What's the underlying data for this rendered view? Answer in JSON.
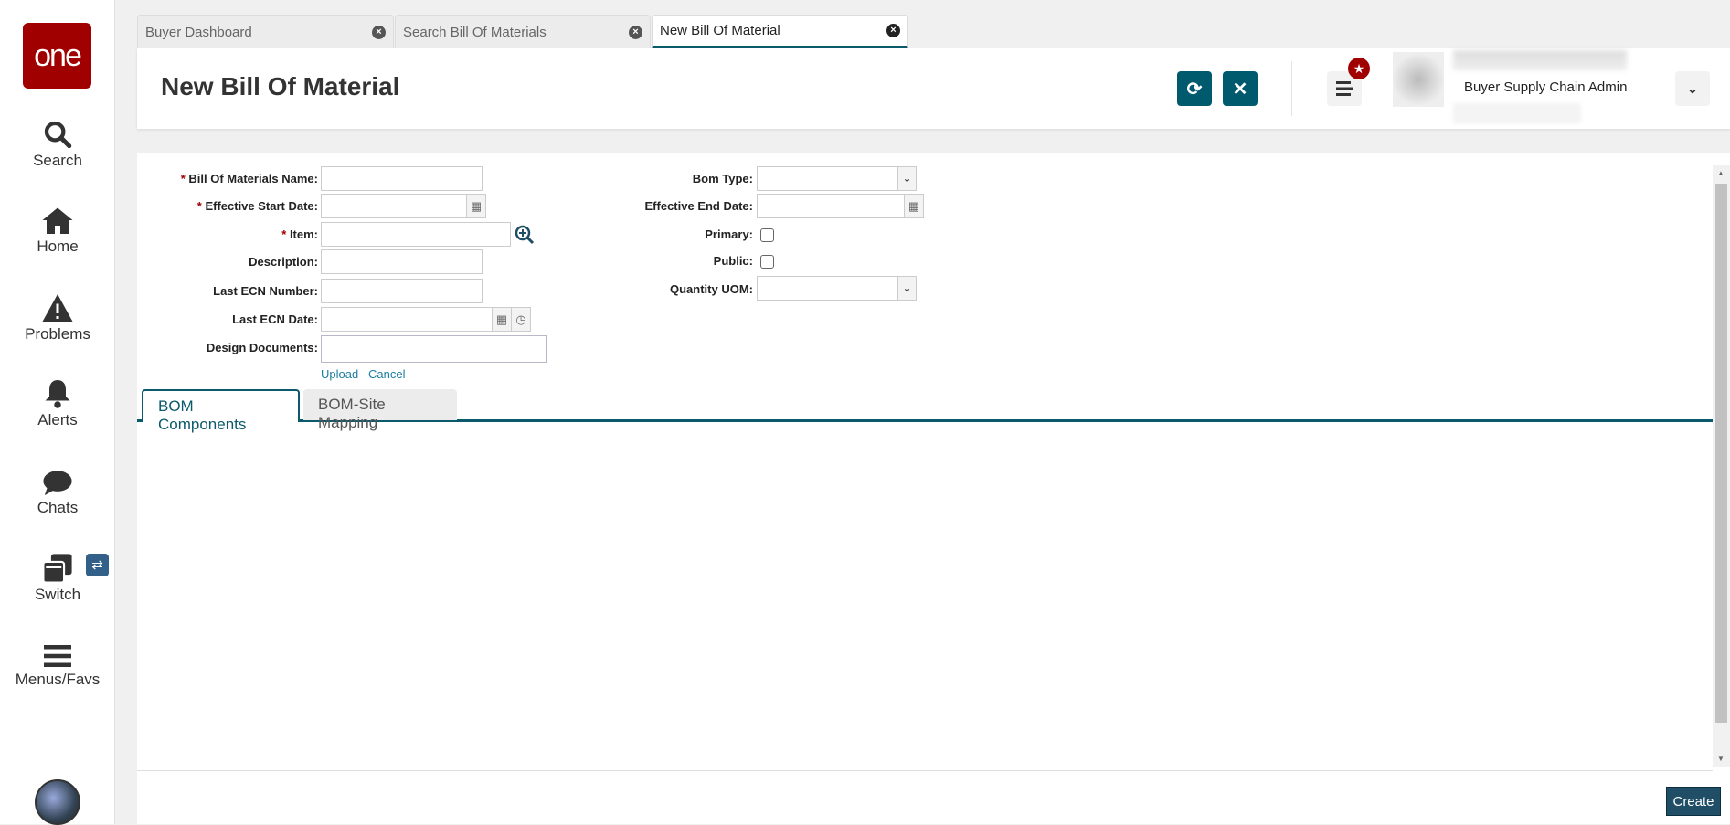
{
  "logo": "one",
  "sidebar": {
    "items": [
      {
        "label": "Search"
      },
      {
        "label": "Home"
      },
      {
        "label": "Problems"
      },
      {
        "label": "Alerts"
      },
      {
        "label": "Chats"
      },
      {
        "label": "Switch"
      },
      {
        "label": "Menus/Favs"
      }
    ]
  },
  "tabs": [
    {
      "label": "Buyer Dashboard"
    },
    {
      "label": "Search Bill Of Materials"
    },
    {
      "label": "New Bill Of Material",
      "active": true
    }
  ],
  "header": {
    "title": "New Bill Of Material",
    "role": "Buyer Supply Chain Admin"
  },
  "form": {
    "left": [
      {
        "label": "Bill Of Materials Name:",
        "required": true
      },
      {
        "label": "Effective Start Date:",
        "required": true
      },
      {
        "label": "Item:",
        "required": true
      },
      {
        "label": "Description:"
      },
      {
        "label": "Last ECN Number:"
      },
      {
        "label": "Last ECN Date:"
      },
      {
        "label": "Design Documents:"
      }
    ],
    "right": [
      {
        "label": "Bom Type:"
      },
      {
        "label": "Effective End Date:"
      },
      {
        "label": "Primary:"
      },
      {
        "label": "Public:"
      },
      {
        "label": "Quantity UOM:"
      }
    ],
    "upload": "Upload",
    "cancel": "Cancel",
    "required_mark": "*"
  },
  "subtabs": [
    {
      "label": "BOM Components"
    },
    {
      "label": "BOM-Site Mapping"
    }
  ],
  "create_label": "Create",
  "colors": {
    "accent": "#005a6e",
    "brand": "#a00000"
  }
}
